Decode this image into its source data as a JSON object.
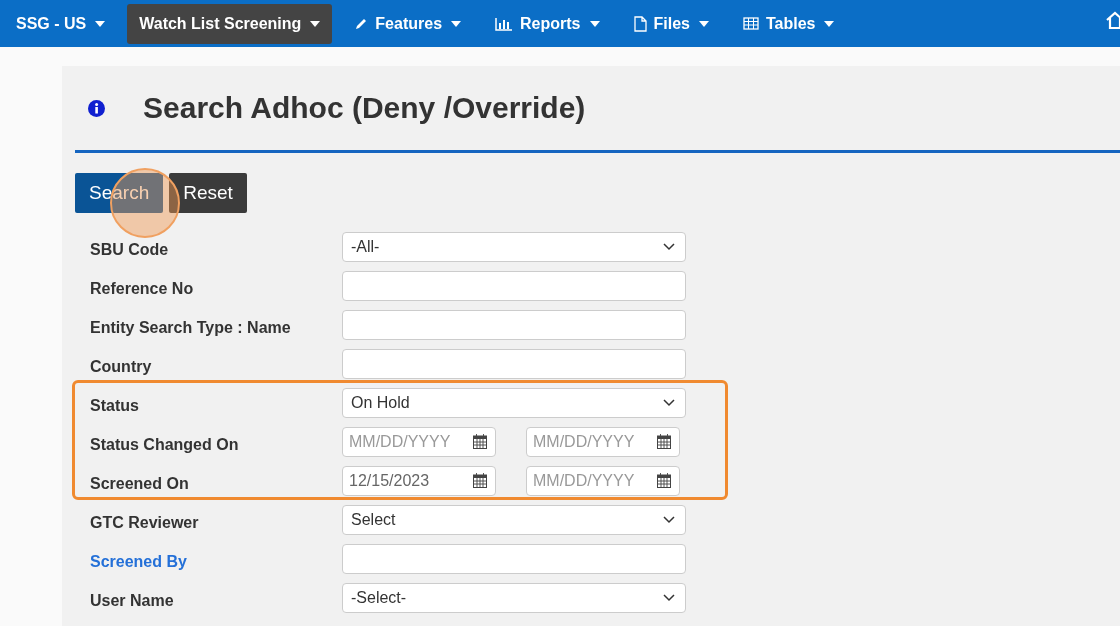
{
  "nav": {
    "items": [
      {
        "label": "SSG - US",
        "selected": false
      },
      {
        "label": "Watch List Screening",
        "selected": true
      },
      {
        "label": "Features",
        "selected": false
      },
      {
        "label": "Reports",
        "selected": false
      },
      {
        "label": "Files",
        "selected": false
      },
      {
        "label": "Tables",
        "selected": false
      }
    ]
  },
  "page": {
    "title": "Search Adhoc (Deny /Override)"
  },
  "buttons": [
    {
      "label": "Search",
      "kind": "primary"
    },
    {
      "label": "Reset",
      "kind": "secondary"
    }
  ],
  "fields": [
    {
      "label": "SBU Code",
      "kind": "select",
      "value": "-All-",
      "link": false,
      "highlighted": false
    },
    {
      "label": "Reference No",
      "kind": "text",
      "link": false,
      "highlighted": false
    },
    {
      "label": "Entity Search Type :  Name",
      "kind": "text",
      "link": false,
      "highlighted": false
    },
    {
      "label": "Country",
      "kind": "text",
      "link": false,
      "highlighted": false
    },
    {
      "label": "Status",
      "kind": "select",
      "value": "On Hold",
      "link": false,
      "highlighted": true
    },
    {
      "label": "Status Changed On",
      "kind": "date-range",
      "from": {
        "placeholder": "MM/DD/YYYY"
      },
      "to": {
        "placeholder": "MM/DD/YYYY"
      },
      "link": false,
      "highlighted": true
    },
    {
      "label": "Screened On",
      "kind": "date-range",
      "from": {
        "value": "12/15/2023"
      },
      "to": {
        "placeholder": "MM/DD/YYYY"
      },
      "link": false,
      "highlighted": true
    },
    {
      "label": "GTC Reviewer",
      "kind": "select",
      "value": "Select",
      "link": false,
      "highlighted": false
    },
    {
      "label": "Screened By",
      "kind": "text",
      "link": true,
      "highlighted": false
    },
    {
      "label": "User Name",
      "kind": "select",
      "value": "-Select-",
      "link": false,
      "highlighted": false
    }
  ]
}
